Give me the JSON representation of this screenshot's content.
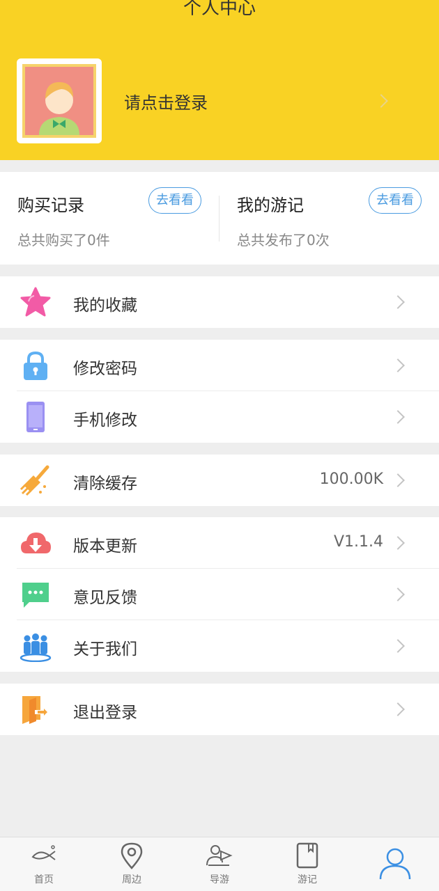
{
  "header": {
    "title": "个人中心"
  },
  "profile": {
    "login_prompt": "请点击登录"
  },
  "stats": [
    {
      "title": "购买记录",
      "button": "去看看",
      "subtitle": "总共购买了0件"
    },
    {
      "title": "我的游记",
      "button": "去看看",
      "subtitle": "总共发布了0次"
    }
  ],
  "menu": {
    "favorites": {
      "label": "我的收藏",
      "icon": "star-icon"
    },
    "change_password": {
      "label": "修改密码",
      "icon": "lock-icon"
    },
    "change_phone": {
      "label": "手机修改",
      "icon": "phone-icon"
    },
    "clear_cache": {
      "label": "清除缓存",
      "value": "100.00K",
      "icon": "broom-icon"
    },
    "version_update": {
      "label": "版本更新",
      "value": "V1.1.4",
      "icon": "cloud-download-icon"
    },
    "feedback": {
      "label": "意见反馈",
      "icon": "chat-bubble-icon"
    },
    "about_us": {
      "label": "关于我们",
      "icon": "team-icon"
    },
    "logout": {
      "label": "退出登录",
      "icon": "exit-icon"
    }
  },
  "tabbar": [
    {
      "label": "首页",
      "icon": "fish-icon"
    },
    {
      "label": "周边",
      "icon": "location-pin-icon"
    },
    {
      "label": "导游",
      "icon": "guide-icon"
    },
    {
      "label": "游记",
      "icon": "notebook-icon"
    },
    {
      "label": "",
      "icon": "user-icon",
      "active": true
    }
  ],
  "colors": {
    "header_bg": "#f9d224",
    "accent_blue": "#4a9be0",
    "page_bg": "#eeeeee"
  }
}
